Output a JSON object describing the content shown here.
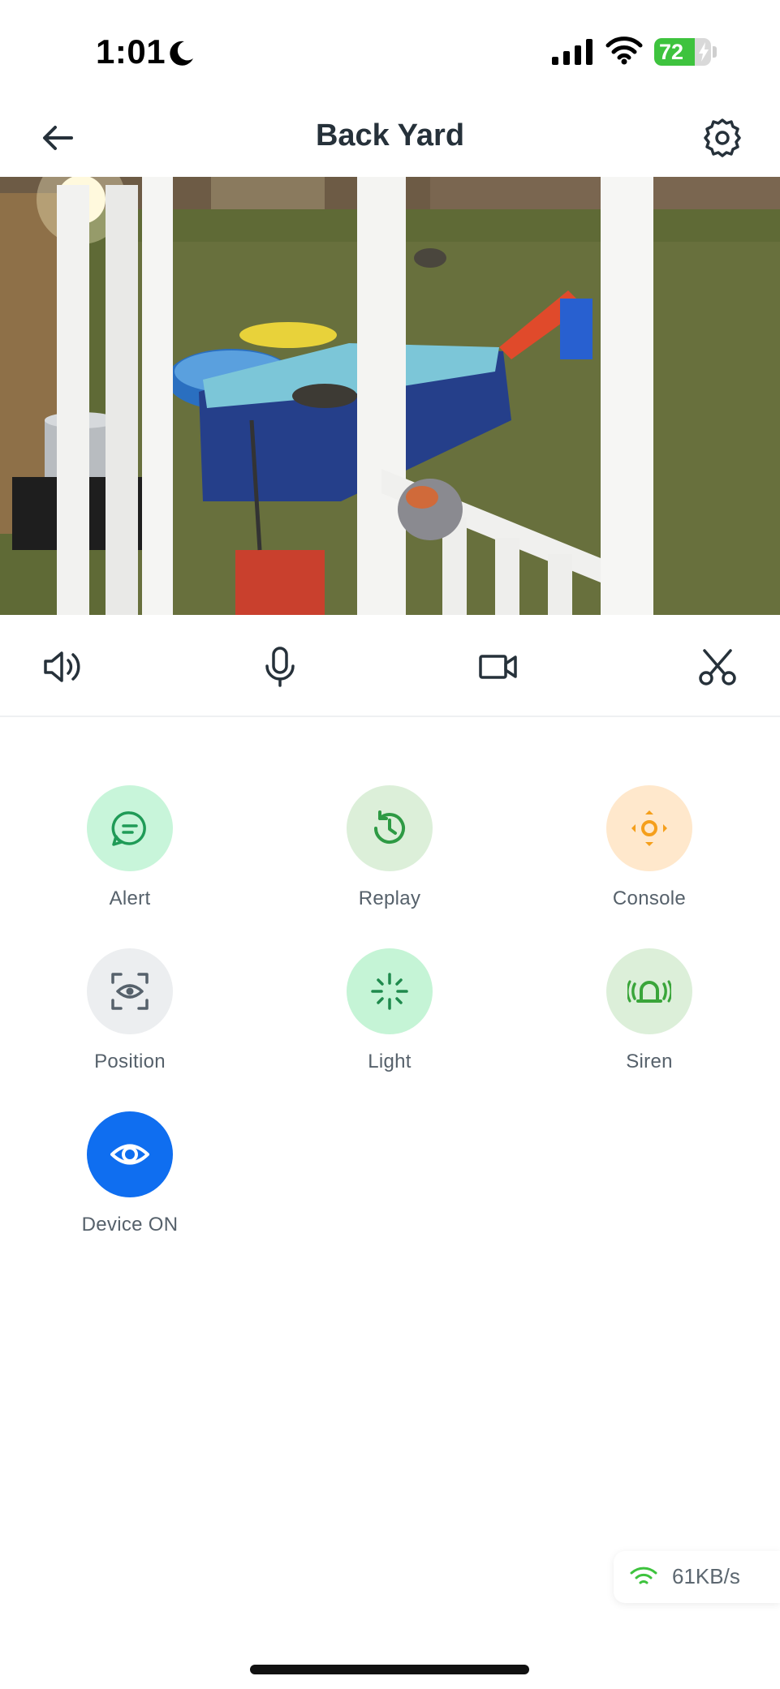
{
  "status_bar": {
    "time": "1:01",
    "battery_level": "72",
    "battery_fraction": 0.72,
    "battery_color": "#3ec33e"
  },
  "header": {
    "title": "Back Yard",
    "back_icon": "arrow-left-icon",
    "settings_icon": "gear-icon"
  },
  "toolbar": {
    "items": [
      "speaker-icon",
      "microphone-icon",
      "video-record-icon",
      "scissors-icon"
    ]
  },
  "actions": [
    {
      "label": "Alert",
      "icon": "message-icon",
      "bg": "#c8f5da",
      "fg": "#1f9b57"
    },
    {
      "label": "Replay",
      "icon": "history-icon",
      "bg": "#dcefd9",
      "fg": "#2e9a44"
    },
    {
      "label": "Console",
      "icon": "direction-pad-icon",
      "bg": "#ffe8cc",
      "fg": "#f59f1b"
    },
    {
      "label": "Position",
      "icon": "focus-eye-icon",
      "bg": "#eceef0",
      "fg": "#56616b"
    },
    {
      "label": "Light",
      "icon": "sparkle-light-icon",
      "bg": "#c5f4d6",
      "fg": "#1f8a4d"
    },
    {
      "label": "Siren",
      "icon": "siren-icon",
      "bg": "#dcefd9",
      "fg": "#3aa53a"
    },
    {
      "label": "Device ON",
      "icon": "eye-icon",
      "bg": "#0f6ef0",
      "fg": "#ffffff"
    }
  ],
  "network": {
    "speed": "61KB/s",
    "icon": "wifi-icon",
    "color": "#3ec33e"
  }
}
